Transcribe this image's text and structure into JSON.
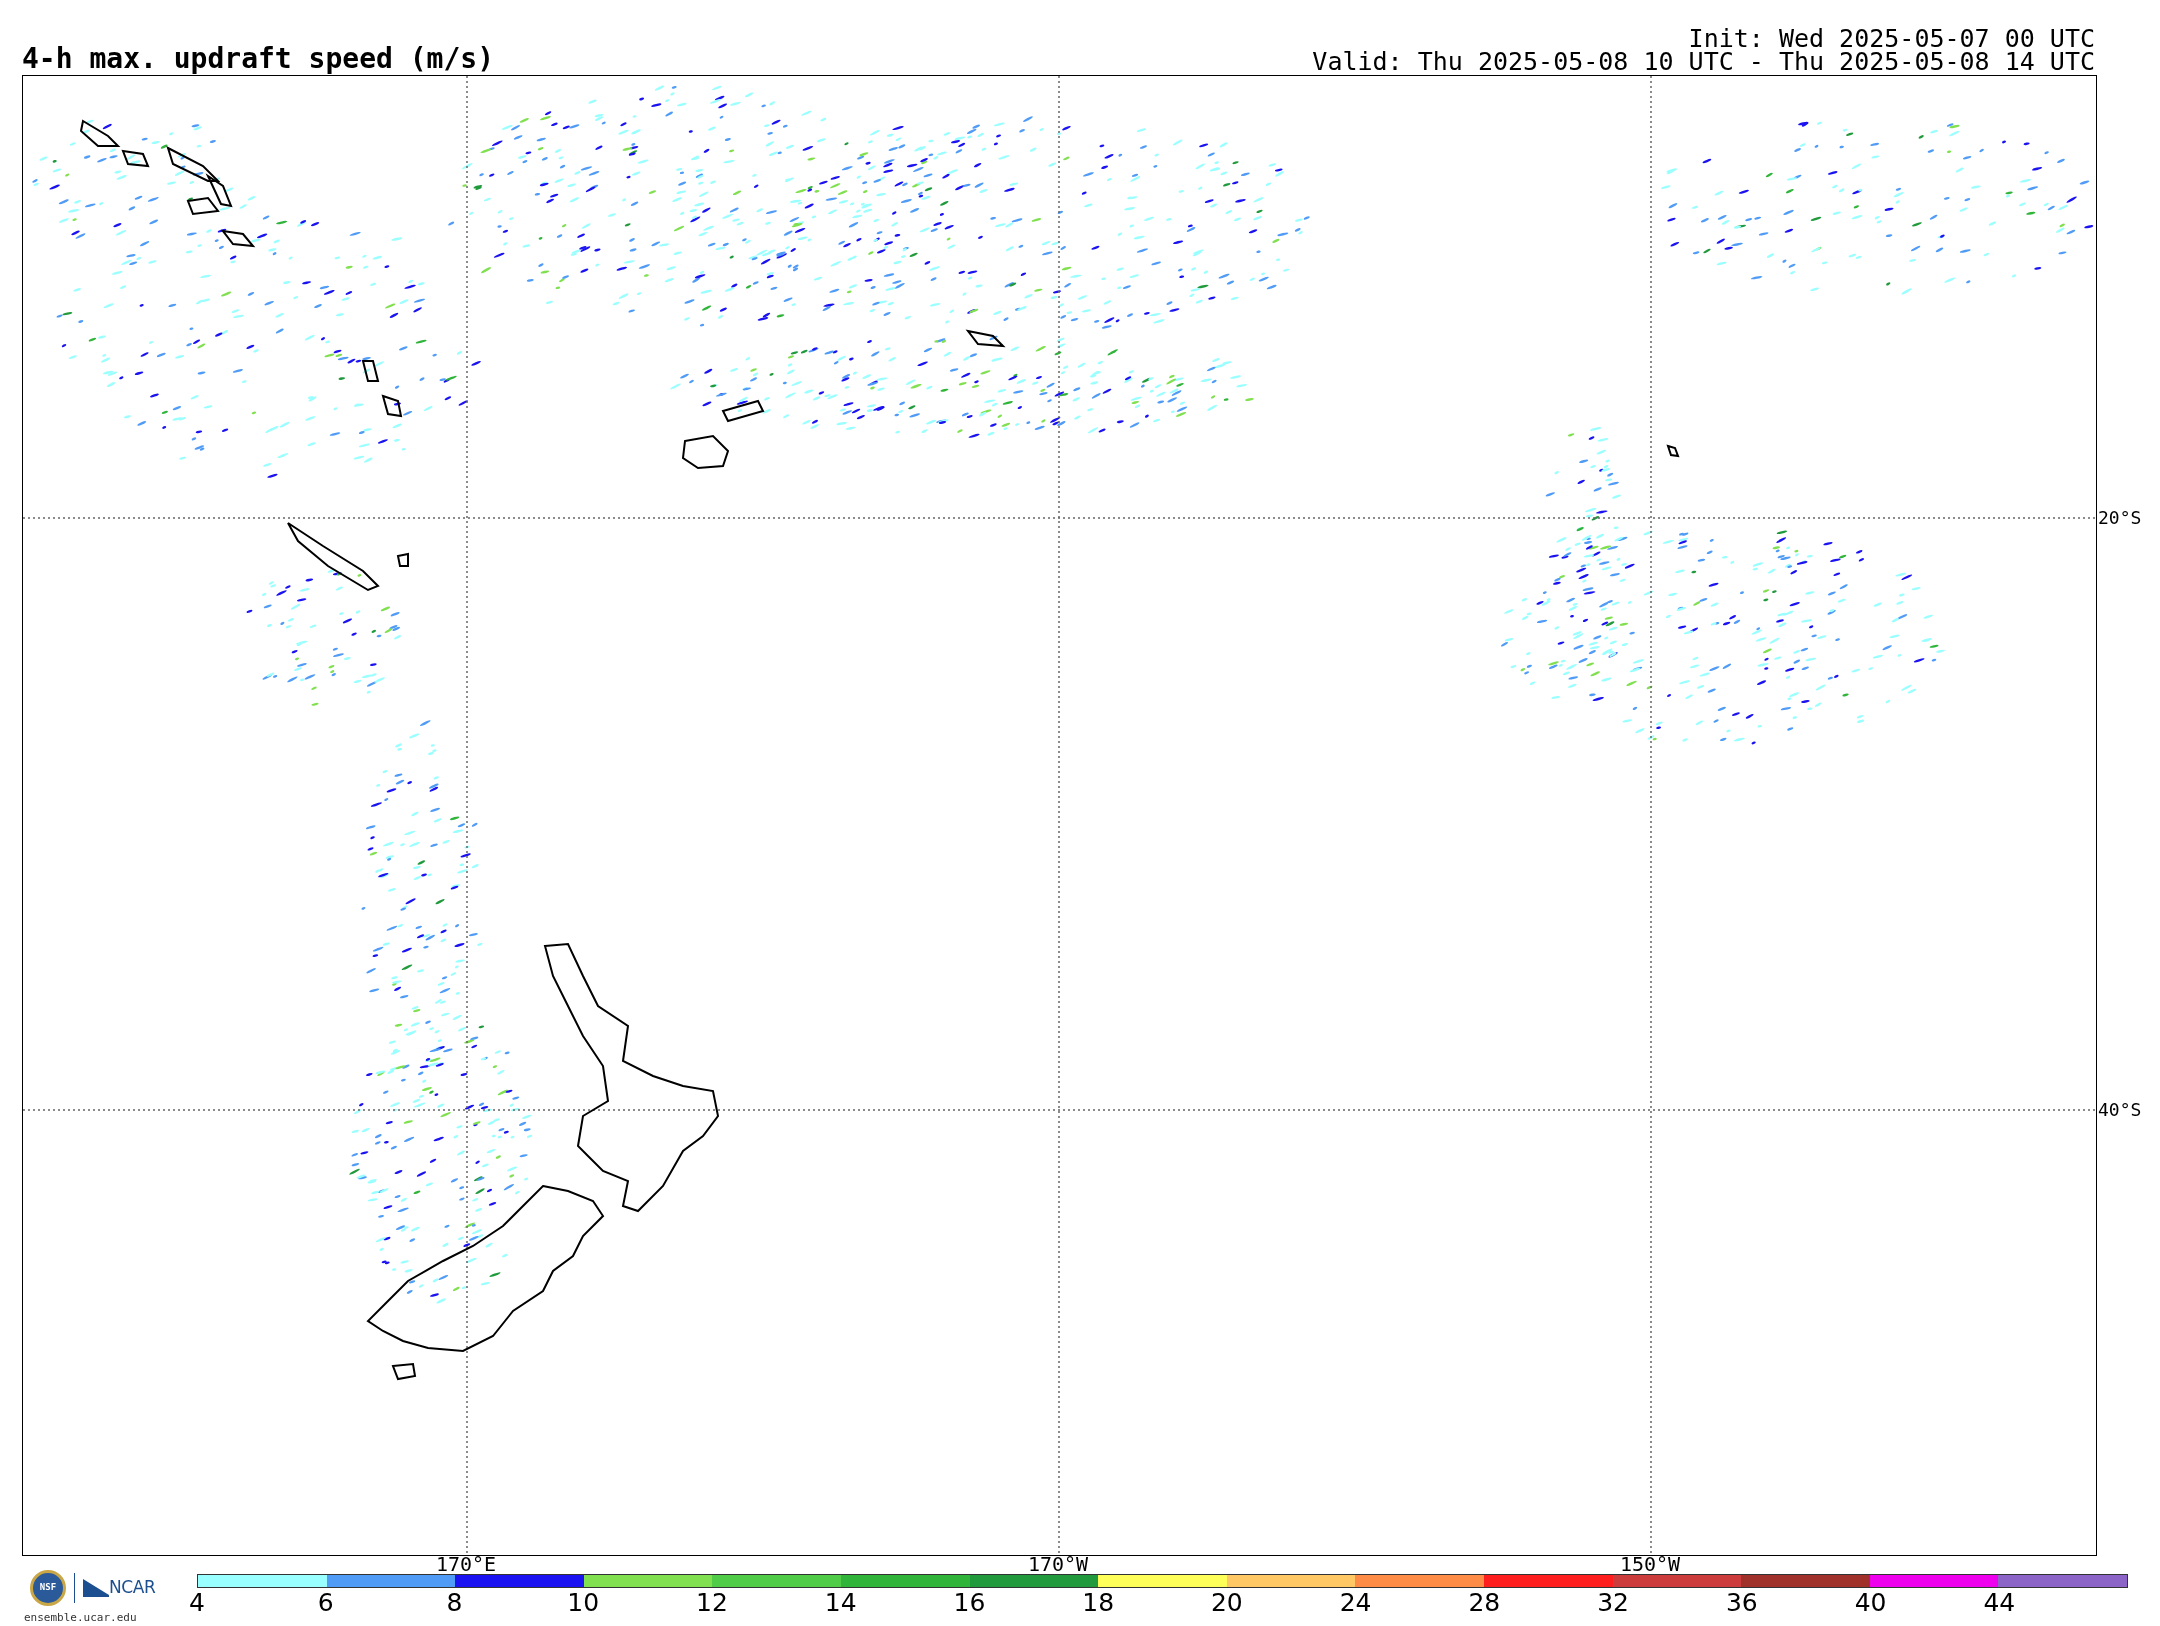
{
  "title": "4-h max. updraft speed (m/s)",
  "init": "Init: Wed 2025-05-07 00 UTC",
  "valid": "Valid: Thu 2025-05-08 10 UTC - Thu 2025-05-08 14 UTC",
  "map": {
    "lat_labels": [
      "20°S",
      "40°S"
    ],
    "lon_labels": [
      "170°E",
      "170°W",
      "150°W"
    ]
  },
  "logos": {
    "nsf": "NSF",
    "ncar": "NCAR",
    "site": "ensemble.ucar.edu"
  },
  "colorbar": [
    {
      "label": "4",
      "color": "#99ffff"
    },
    {
      "label": "6",
      "color": "#4f9bf5"
    },
    {
      "label": "8",
      "color": "#1a12f0"
    },
    {
      "label": "10",
      "color": "#80e050"
    },
    {
      "label": "12",
      "color": "#50cc48"
    },
    {
      "label": "14",
      "color": "#30b43a"
    },
    {
      "label": "16",
      "color": "#209a3c"
    },
    {
      "label": "18",
      "color": "#ffff5a"
    },
    {
      "label": "20",
      "color": "#ffc864"
    },
    {
      "label": "24",
      "color": "#ff8c46"
    },
    {
      "label": "28",
      "color": "#ff1e1e"
    },
    {
      "label": "32",
      "color": "#cc3c3c"
    },
    {
      "label": "36",
      "color": "#a0302a"
    },
    {
      "label": "40",
      "color": "#ee00ee"
    },
    {
      "label": "44",
      "color": "#8c64c8"
    }
  ]
}
